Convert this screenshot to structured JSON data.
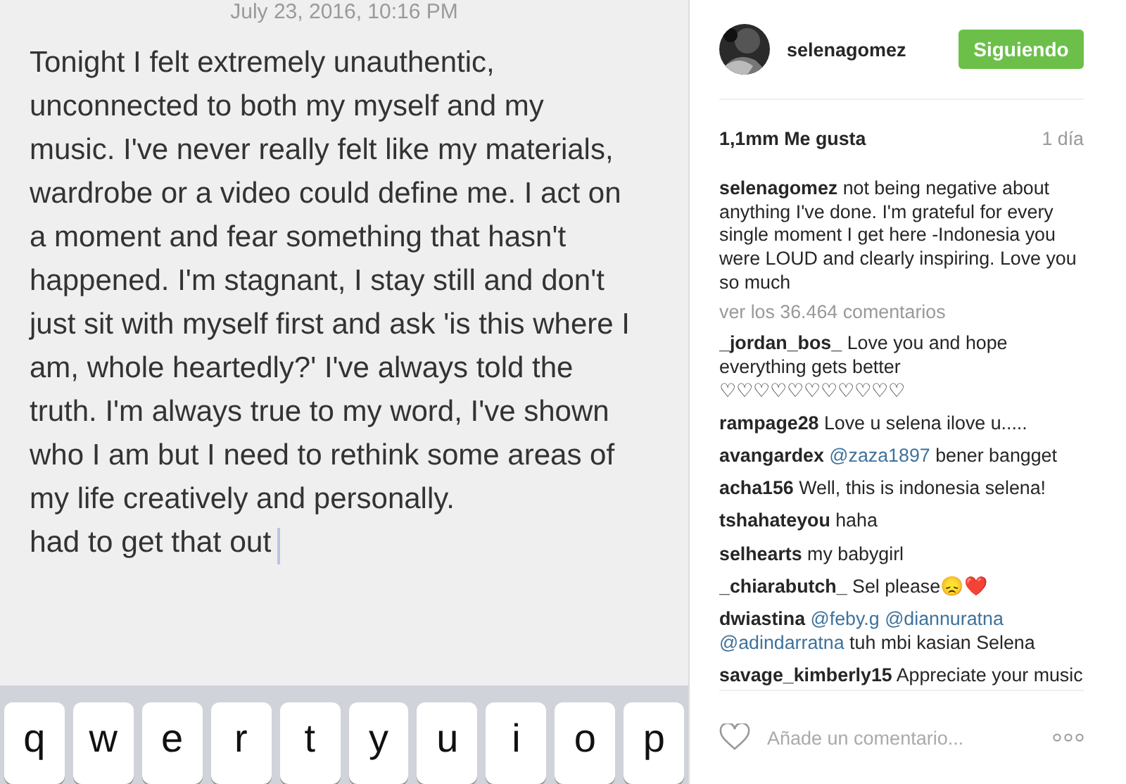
{
  "note": {
    "date": "July 23, 2016, 10:16 PM",
    "body": "Tonight I felt extremely unauthentic, unconnected to both my myself and my music. I've never really felt like my materials, wardrobe or a video could define me. I act on a moment and fear something that hasn't happened. I'm stagnant, I stay still and don't just sit with myself first and ask 'is this where I am, whole heartedly?' I've always told the truth. I'm always true to my word, I've shown who I am but I need to rethink some areas of my life creatively and personally.",
    "last_line": "had to get that out",
    "keys": [
      "q",
      "w",
      "e",
      "r",
      "t",
      "y",
      "u",
      "i",
      "o",
      "p"
    ]
  },
  "post": {
    "username": "selenagomez",
    "follow_button": "Siguiendo",
    "likes": "1,1mm Me gusta",
    "time": "1 día",
    "caption": {
      "user": "selenagomez",
      "text": "not being negative about anything I've done. I'm grateful for every single moment I get here -Indonesia you were LOUD and clearly inspiring. Love you so much"
    },
    "view_comments": "ver los 36.464 comentarios",
    "comments": [
      {
        "user": "_jordan_bos_",
        "parts": [
          {
            "kind": "text",
            "text": "Love you and hope everything gets better\n♡♡♡♡♡♡♡♡♡♡♡"
          }
        ]
      },
      {
        "user": "rampage28",
        "parts": [
          {
            "kind": "text",
            "text": "Love u selena ilove u....."
          }
        ]
      },
      {
        "user": "avangardex",
        "parts": [
          {
            "kind": "mention",
            "text": "@zaza1897"
          },
          {
            "kind": "text",
            "text": "bener bangget"
          }
        ]
      },
      {
        "user": "acha156",
        "parts": [
          {
            "kind": "text",
            "text": "Well, this is indonesia selena!"
          }
        ]
      },
      {
        "user": "tshahateyou",
        "parts": [
          {
            "kind": "text",
            "text": "haha"
          }
        ]
      },
      {
        "user": "selhearts",
        "parts": [
          {
            "kind": "text",
            "text": "my babygirl"
          }
        ]
      },
      {
        "user": "_chiarabutch_",
        "parts": [
          {
            "kind": "text",
            "text": "Sel please😞❤️"
          }
        ]
      },
      {
        "user": "dwiastina",
        "parts": [
          {
            "kind": "mention",
            "text": "@feby.g"
          },
          {
            "kind": "mention",
            "text": "@diannuratna"
          },
          {
            "kind": "mention",
            "text": "@adindarratna"
          },
          {
            "kind": "text",
            "text": "tuh mbi kasian Selena"
          }
        ]
      },
      {
        "user": "savage_kimberly15",
        "parts": [
          {
            "kind": "text",
            "text": "Appreciate your music"
          }
        ]
      }
    ],
    "comment_placeholder": "Añade un comentario..."
  }
}
